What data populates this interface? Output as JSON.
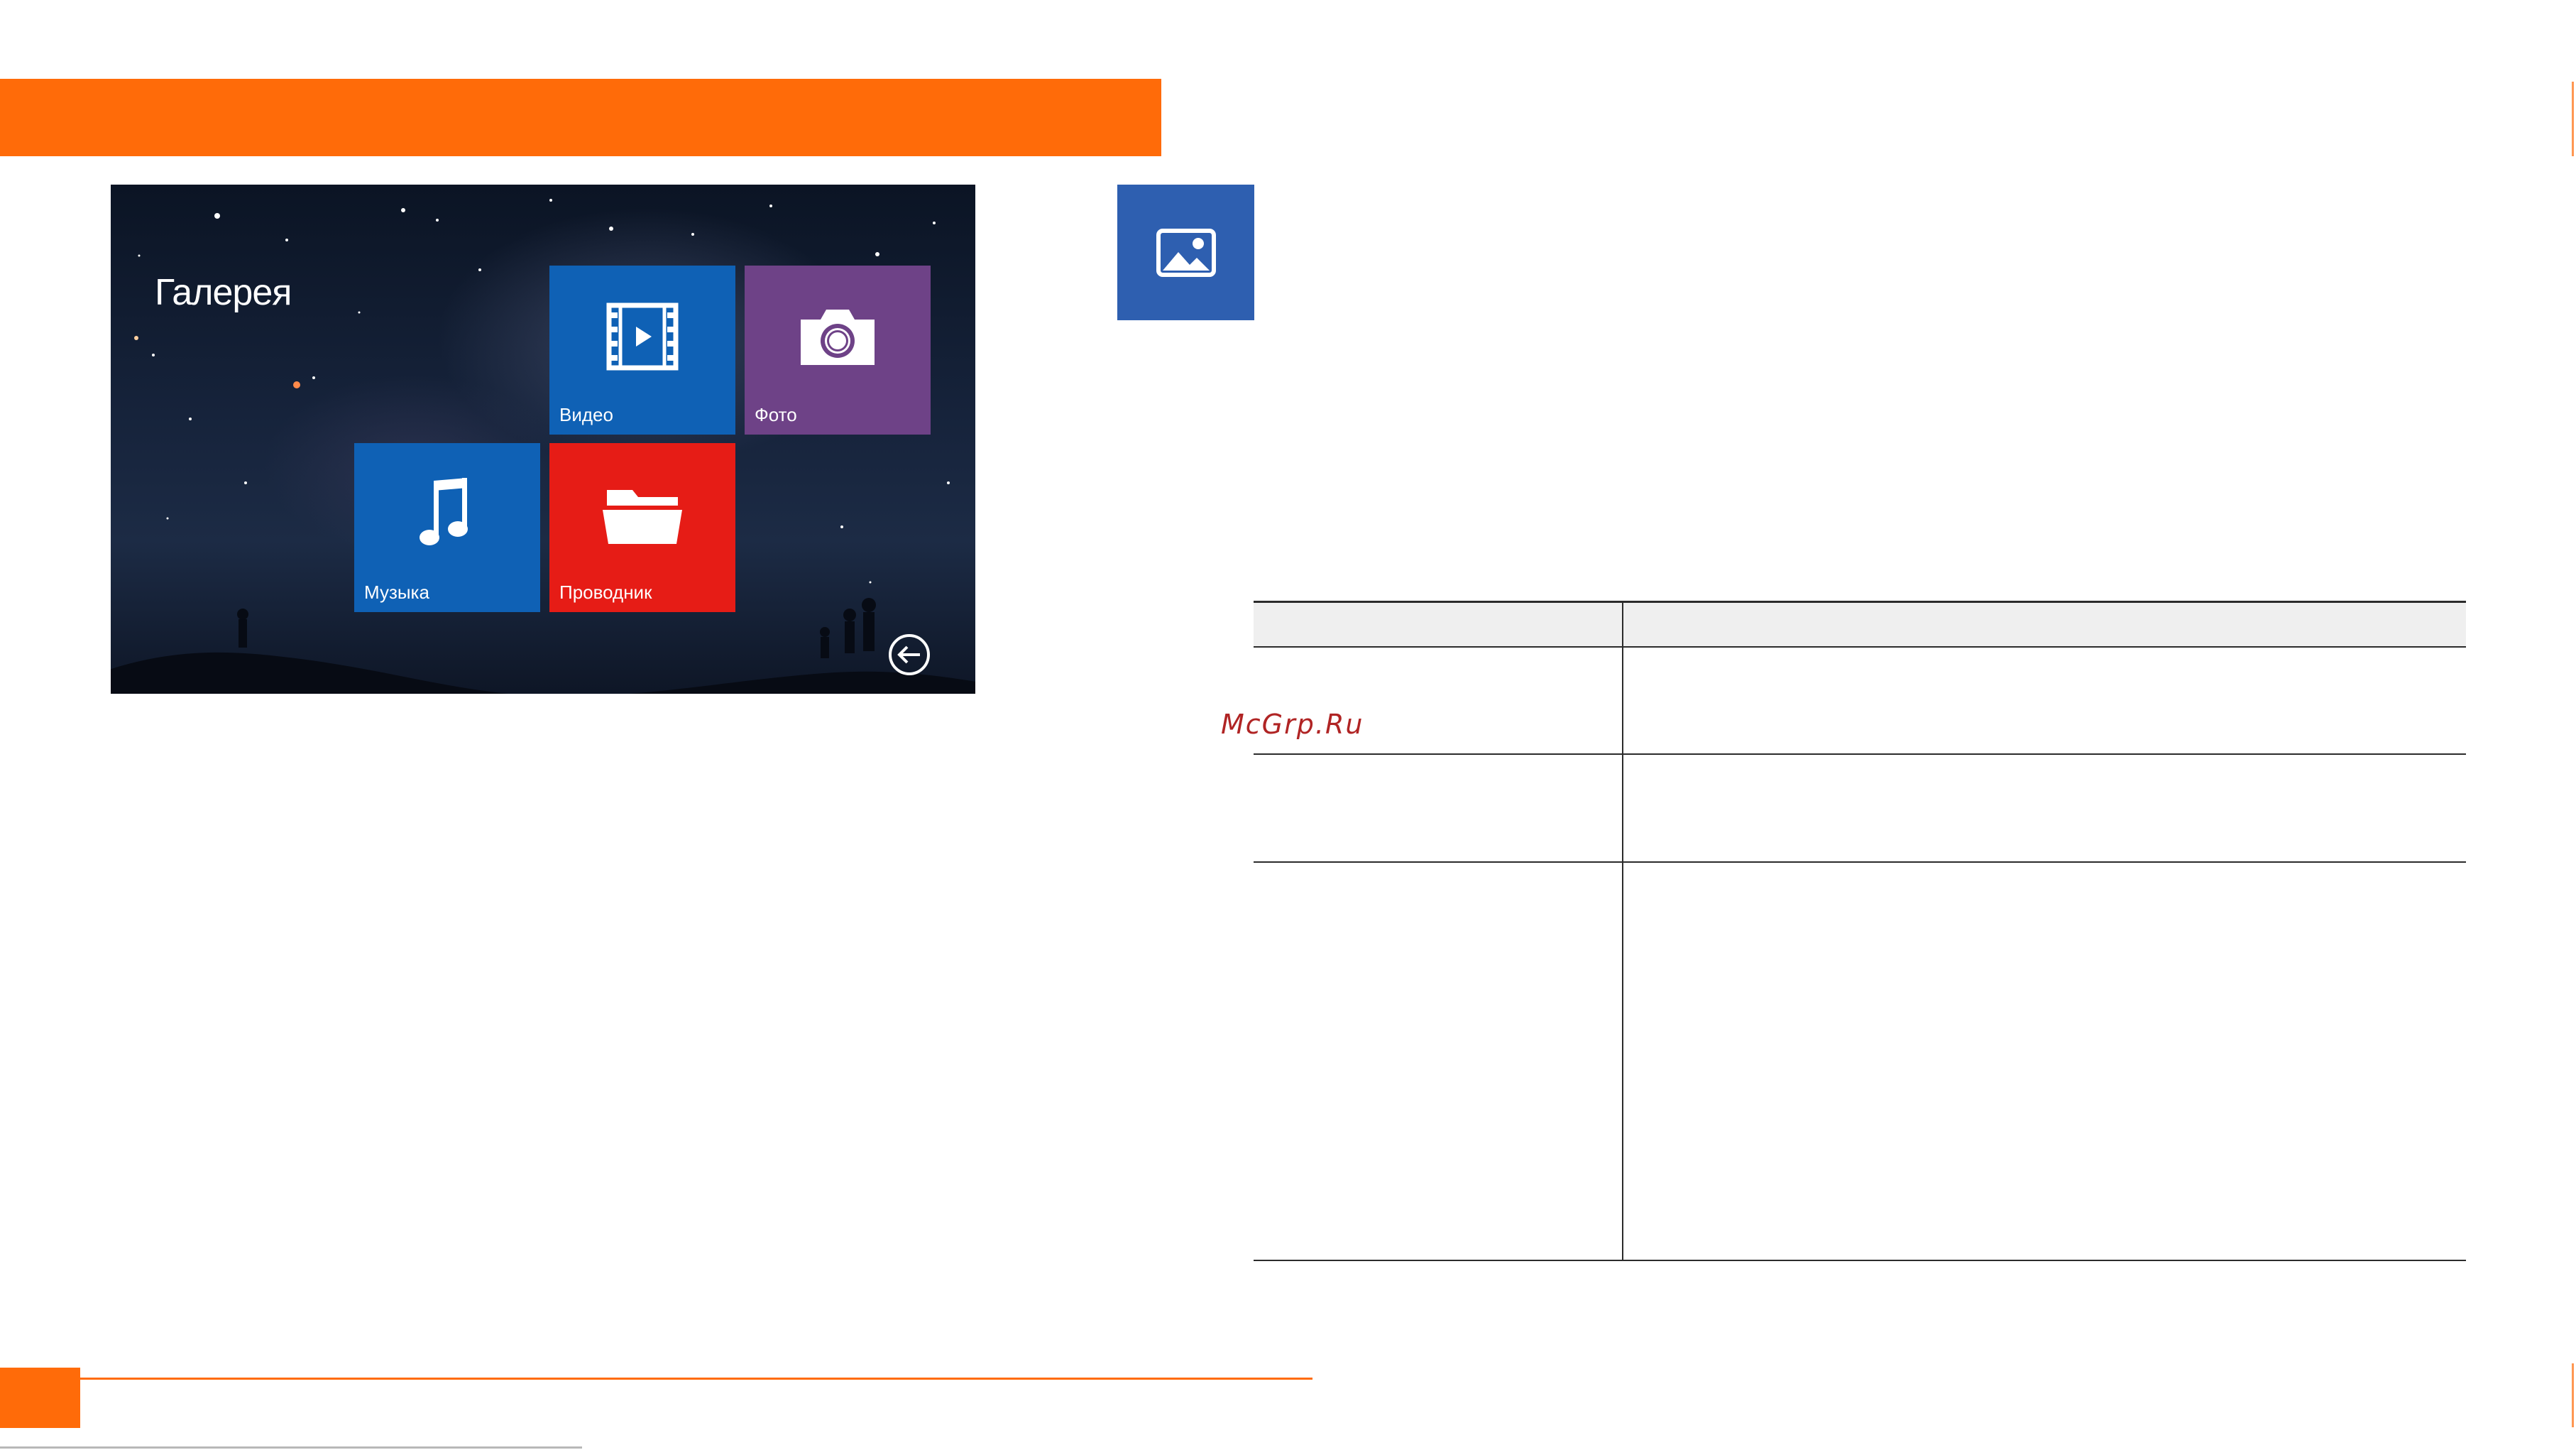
{
  "header": {
    "accent_color": "#ff6b09"
  },
  "device_screen": {
    "title": "Галерея",
    "tiles": [
      {
        "label": "Видео",
        "icon": "film-icon",
        "color": "#0f61b5"
      },
      {
        "label": "Фото",
        "icon": "camera-icon",
        "color": "#6e4287"
      },
      {
        "label": "Музыка",
        "icon": "music-note-icon",
        "color": "#0f61b5"
      },
      {
        "label": "Проводник",
        "icon": "folder-icon",
        "color": "#e61c16"
      }
    ],
    "back_icon": "back-arrow-icon"
  },
  "section_icon": {
    "icon": "image-icon",
    "color": "#2e5fb0"
  },
  "table": {
    "headers": [
      "",
      ""
    ],
    "rows": [
      [
        "",
        ""
      ],
      [
        "",
        ""
      ],
      [
        "",
        ""
      ]
    ]
  },
  "watermark": "McGrp.Ru",
  "footer": {
    "page_number": ""
  }
}
